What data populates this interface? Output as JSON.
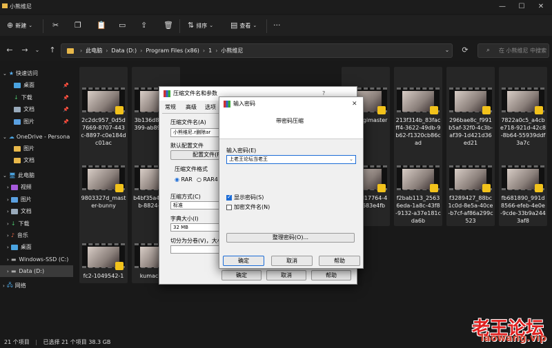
{
  "window": {
    "title": "小熊维尼",
    "minimize": "—",
    "maximize": "☐",
    "close": "✕"
  },
  "toolbar": {
    "new_label": "新建",
    "sort_label": "排序",
    "view_label": "查看",
    "more": "···"
  },
  "address": {
    "breadcrumb": [
      "此电脑",
      "Data (D:)",
      "Program Files (x86)",
      "1",
      "小熊维尼"
    ],
    "separator": "›",
    "search_placeholder": "在 小熊维尼 中搜索"
  },
  "sidebar": {
    "items": [
      {
        "label": "快速访问",
        "pinned": false
      },
      {
        "label": "桌面",
        "pinned": true
      },
      {
        "label": "下载",
        "pinned": true
      },
      {
        "label": "文档",
        "pinned": true
      },
      {
        "label": "图片",
        "pinned": true
      },
      {
        "label": "OneDrive - Persona",
        "pinned": false
      },
      {
        "label": "图片",
        "pinned": false
      },
      {
        "label": "文档",
        "pinned": false
      },
      {
        "label": "此电脑",
        "pinned": false
      },
      {
        "label": "视频",
        "pinned": false
      },
      {
        "label": "图片",
        "pinned": false
      },
      {
        "label": "文档",
        "pinned": false
      },
      {
        "label": "下载",
        "pinned": false
      },
      {
        "label": "音乐",
        "pinned": false
      },
      {
        "label": "桌面",
        "pinned": false
      },
      {
        "label": "Windows-SSD (C:)",
        "pinned": false
      },
      {
        "label": "Data (D:)",
        "pinned": false
      },
      {
        "label": "网络",
        "pinned": false
      }
    ]
  },
  "files": [
    {
      "name": "2c2dc957_0d5d7669-8707-443c-8897-c0e184dc01ac"
    },
    {
      "name": "3b136d8de1cc-399-ab89c0469"
    },
    {
      "name": "ce_usagimaster"
    },
    {
      "name": "213f314b_83facff4-3622-49db-9b62-f1320cb86cad"
    },
    {
      "name": "296bae8c_f991b5af-32f0-4c3b-af39-1d421d36ed21"
    },
    {
      "name": "7822a0c5_a4cbe718-921d-42c8-8b64-55939ddf3a7c"
    },
    {
      "name": "9803327d_master-bunny"
    },
    {
      "name": "b4bf35a4ac3-4bb-8824-b214"
    },
    {
      "name": "248_ed17764-4cf-ff2f683e4fb"
    },
    {
      "name": "f2bab113_25636eda-1a8c-43f8-9132-a37e181cda6b"
    },
    {
      "name": "f3289427_88bc1c0d-8e5a-40ce-b7cf-af86a299c523"
    },
    {
      "name": "fb681890_991d8566-efeb-4e0e-9cde-33b9a2443af8"
    },
    {
      "name": "fc2-1049542-1"
    },
    {
      "name": "kumachahe"
    }
  ],
  "status": {
    "count": "21 个项目",
    "selected": "已选择 21 个项目  38.3 GB"
  },
  "archive_dialog": {
    "title": "压缩文件名和参数",
    "help_q": "?",
    "tabs": [
      "常规",
      "高级",
      "选项"
    ],
    "filename_label": "压缩文件名(A)",
    "filename_value": "小熊维尼.r删除ar",
    "default_profile_label": "默认配置文件",
    "profile_button": "配置文件(F)",
    "format_label": "压缩文件格式",
    "format_rar": "RAR",
    "format_rar4": "RAR4",
    "method_label": "压缩方式(C)",
    "method_value": "标准",
    "dict_label": "字典大小(I)",
    "dict_value": "32 MB",
    "split_label": "切分为分卷(V)，大小",
    "ok": "确定",
    "cancel": "取消",
    "help": "帮助"
  },
  "password_dialog": {
    "title": "输入密码",
    "close": "✕",
    "subtitle": "带密码压缩",
    "password_label": "输入密码(E)",
    "password_value": "上老王论坛当老王",
    "show_password": "显示密码(S)",
    "show_password_checked": true,
    "encrypt_names": "加密文件名(N)",
    "encrypt_names_checked": false,
    "organize_button": "整理密码(O)...",
    "ok": "确定",
    "cancel": "取消",
    "help": "帮助"
  },
  "watermark": {
    "main": "老王论坛",
    "url": "laowang.vip"
  }
}
